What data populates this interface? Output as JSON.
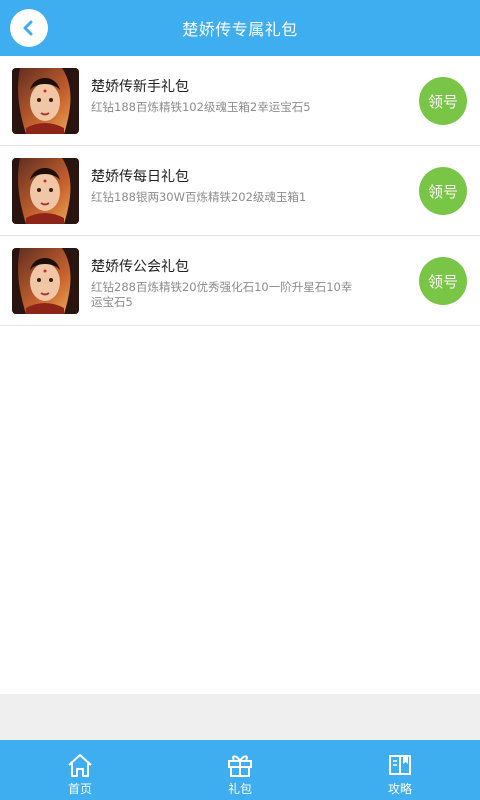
{
  "header": {
    "title": "楚娇传专属礼包",
    "back_icon": "back-arrow-icon"
  },
  "colors": {
    "primary": "#3eaef1",
    "claim_button": "#79c545"
  },
  "gifts": [
    {
      "title": "楚娇传新手礼包",
      "desc": "红钻188百炼精铁102级魂玉箱2幸运宝石5",
      "button": "领号"
    },
    {
      "title": "楚娇传每日礼包",
      "desc": "红钻188银两30W百炼精铁202级魂玉箱1",
      "button": "领号"
    },
    {
      "title": "楚娇传公会礼包",
      "desc": "红钻288百炼精铁20优秀强化石10一阶升星石10幸运宝石5",
      "button": "领号"
    }
  ],
  "tabbar": [
    {
      "label": "首页",
      "icon": "home-icon"
    },
    {
      "label": "礼包",
      "icon": "gift-icon"
    },
    {
      "label": "攻略",
      "icon": "book-icon"
    }
  ]
}
